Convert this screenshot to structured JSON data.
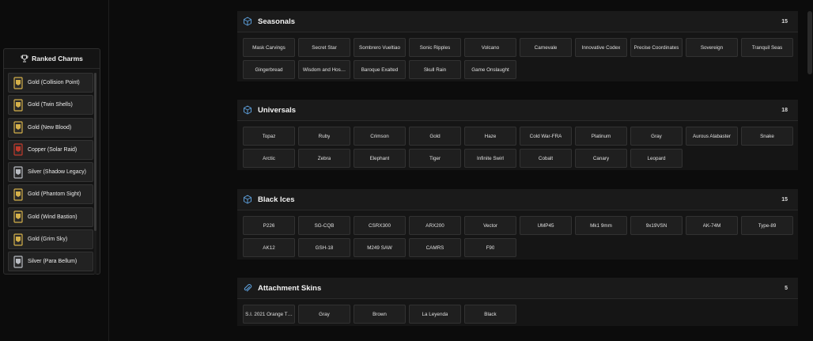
{
  "ranked_charms": {
    "title": "Ranked Charms",
    "items": [
      {
        "label": "Gold (Collision Point)",
        "tier": "gold"
      },
      {
        "label": "Gold (Twin Shells)",
        "tier": "gold"
      },
      {
        "label": "Gold (New Blood)",
        "tier": "gold"
      },
      {
        "label": "Copper (Solar Raid)",
        "tier": "copper"
      },
      {
        "label": "Silver (Shadow Legacy)",
        "tier": "silver"
      },
      {
        "label": "Gold (Phantom Sight)",
        "tier": "gold"
      },
      {
        "label": "Gold (Wind Bastion)",
        "tier": "gold"
      },
      {
        "label": "Gold (Grim Sky)",
        "tier": "gold"
      },
      {
        "label": "Silver (Para Bellum)",
        "tier": "silver"
      }
    ]
  },
  "sections": [
    {
      "title": "Seasonals",
      "count": "15",
      "icon": "cube-icon",
      "items": [
        "Mask Carvings",
        "Secret Star",
        "Sombrero Vueltiao",
        "Sonic Ripples",
        "Volcano",
        "Carnevale",
        "Innovative Codex",
        "Precise Coordinates",
        "Sovereign",
        "Tranquil Seas",
        "Gingerbread",
        "Wisdom and Hos…",
        "Baroque Exalted",
        "Skull Rain",
        "Game Onslaught"
      ]
    },
    {
      "title": "Universals",
      "count": "18",
      "icon": "cube-icon",
      "items": [
        "Topaz",
        "Ruby",
        "Crimson",
        "Gold",
        "Haze",
        "Cold War-FRA",
        "Platinum",
        "Gray",
        "Aurous Alabaster",
        "Snake",
        "Arctic",
        "Zebra",
        "Elephant",
        "Tiger",
        "Infinite Swirl",
        "Cobalt",
        "Canary",
        "Leopard"
      ]
    },
    {
      "title": "Black Ices",
      "count": "15",
      "icon": "cube-icon",
      "items": [
        "P226",
        "SG-CQB",
        "CSRX300",
        "ARX200",
        "Vector",
        "UMP45",
        "Mk1 9mm",
        "9x19VSN",
        "AK-74M",
        "Type-89",
        "AK12",
        "GSH-18",
        "M249 SAW",
        "CAMRS",
        "F90"
      ]
    },
    {
      "title": "Attachment Skins",
      "count": "5",
      "icon": "paperclip-icon",
      "items": [
        "S.I. 2021 Orange T…",
        "Gray",
        "Brown",
        "La Leyenda",
        "Black"
      ]
    }
  ],
  "colors": {
    "accent_icon": "#5b9bd5",
    "gold": "#d4b04a",
    "silver": "#b9bcc2",
    "copper": "#c0392b"
  }
}
